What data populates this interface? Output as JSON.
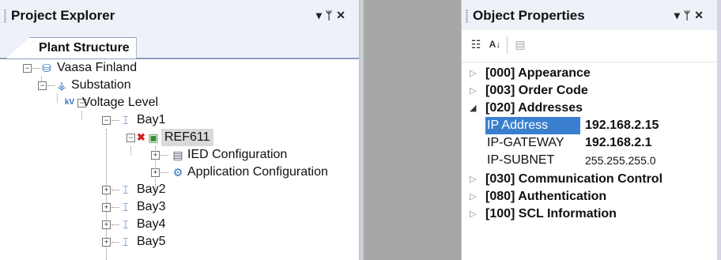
{
  "project_explorer": {
    "title": "Project Explorer",
    "controls": {
      "dropdown": "▾",
      "pin": "ᛘ",
      "close": "✕"
    },
    "tab": "Plant Structure",
    "tree": [
      {
        "label": "Vaasa Finland",
        "icon": "database-icon",
        "expander": "−"
      },
      {
        "label": "Substation",
        "icon": "substation-icon",
        "expander": "−"
      },
      {
        "label": "Voltage Level",
        "icon": "voltage-level-icon",
        "expander": "−"
      },
      {
        "label": "Bay1",
        "icon": "bay-icon",
        "expander": "−"
      },
      {
        "label": "REF611",
        "icon": "ied-icon",
        "expander": "−",
        "status_mark": "✖",
        "selected": true
      },
      {
        "label": "IED Configuration",
        "icon": "ied-configuration-icon",
        "expander": "+"
      },
      {
        "label": "Application Configuration",
        "icon": "application-configuration-icon",
        "expander": "+"
      },
      {
        "label": "Bay2",
        "icon": "bay-icon",
        "expander": "+"
      },
      {
        "label": "Bay3",
        "icon": "bay-icon",
        "expander": "+"
      },
      {
        "label": "Bay4",
        "icon": "bay-icon",
        "expander": "+"
      },
      {
        "label": "Bay5",
        "icon": "bay-icon",
        "expander": "+"
      }
    ]
  },
  "object_properties": {
    "title": "Object Properties",
    "controls": {
      "dropdown": "▾",
      "pin": "ᛘ",
      "close": "✕"
    },
    "toolbar": {
      "categorized": "☷",
      "alphabetical": "A↓",
      "property_pages": "▤"
    },
    "categories": [
      {
        "label": "[000] Appearance",
        "expanded": false,
        "arrow": "▷"
      },
      {
        "label": "[003] Order Code",
        "expanded": false,
        "arrow": "▷"
      },
      {
        "label": "[020] Addresses",
        "expanded": true,
        "arrow": "◢"
      },
      {
        "label": "[030] Communication Control",
        "expanded": false,
        "arrow": "▷"
      },
      {
        "label": "[080] Authentication",
        "expanded": false,
        "arrow": "▷"
      },
      {
        "label": "[100] SCL Information",
        "expanded": false,
        "arrow": "▷"
      }
    ],
    "address_properties": [
      {
        "name": "IP Address",
        "value": "192.168.2.15",
        "selected": true
      },
      {
        "name": "IP-GATEWAY",
        "value": "192.168.2.1"
      },
      {
        "name": "IP-SUBNET",
        "value": "255.255.255.0"
      }
    ]
  },
  "colors": {
    "selection": "#3a7fcf",
    "tree_selection": "#d9d9d9",
    "error_mark": "#d02020"
  }
}
